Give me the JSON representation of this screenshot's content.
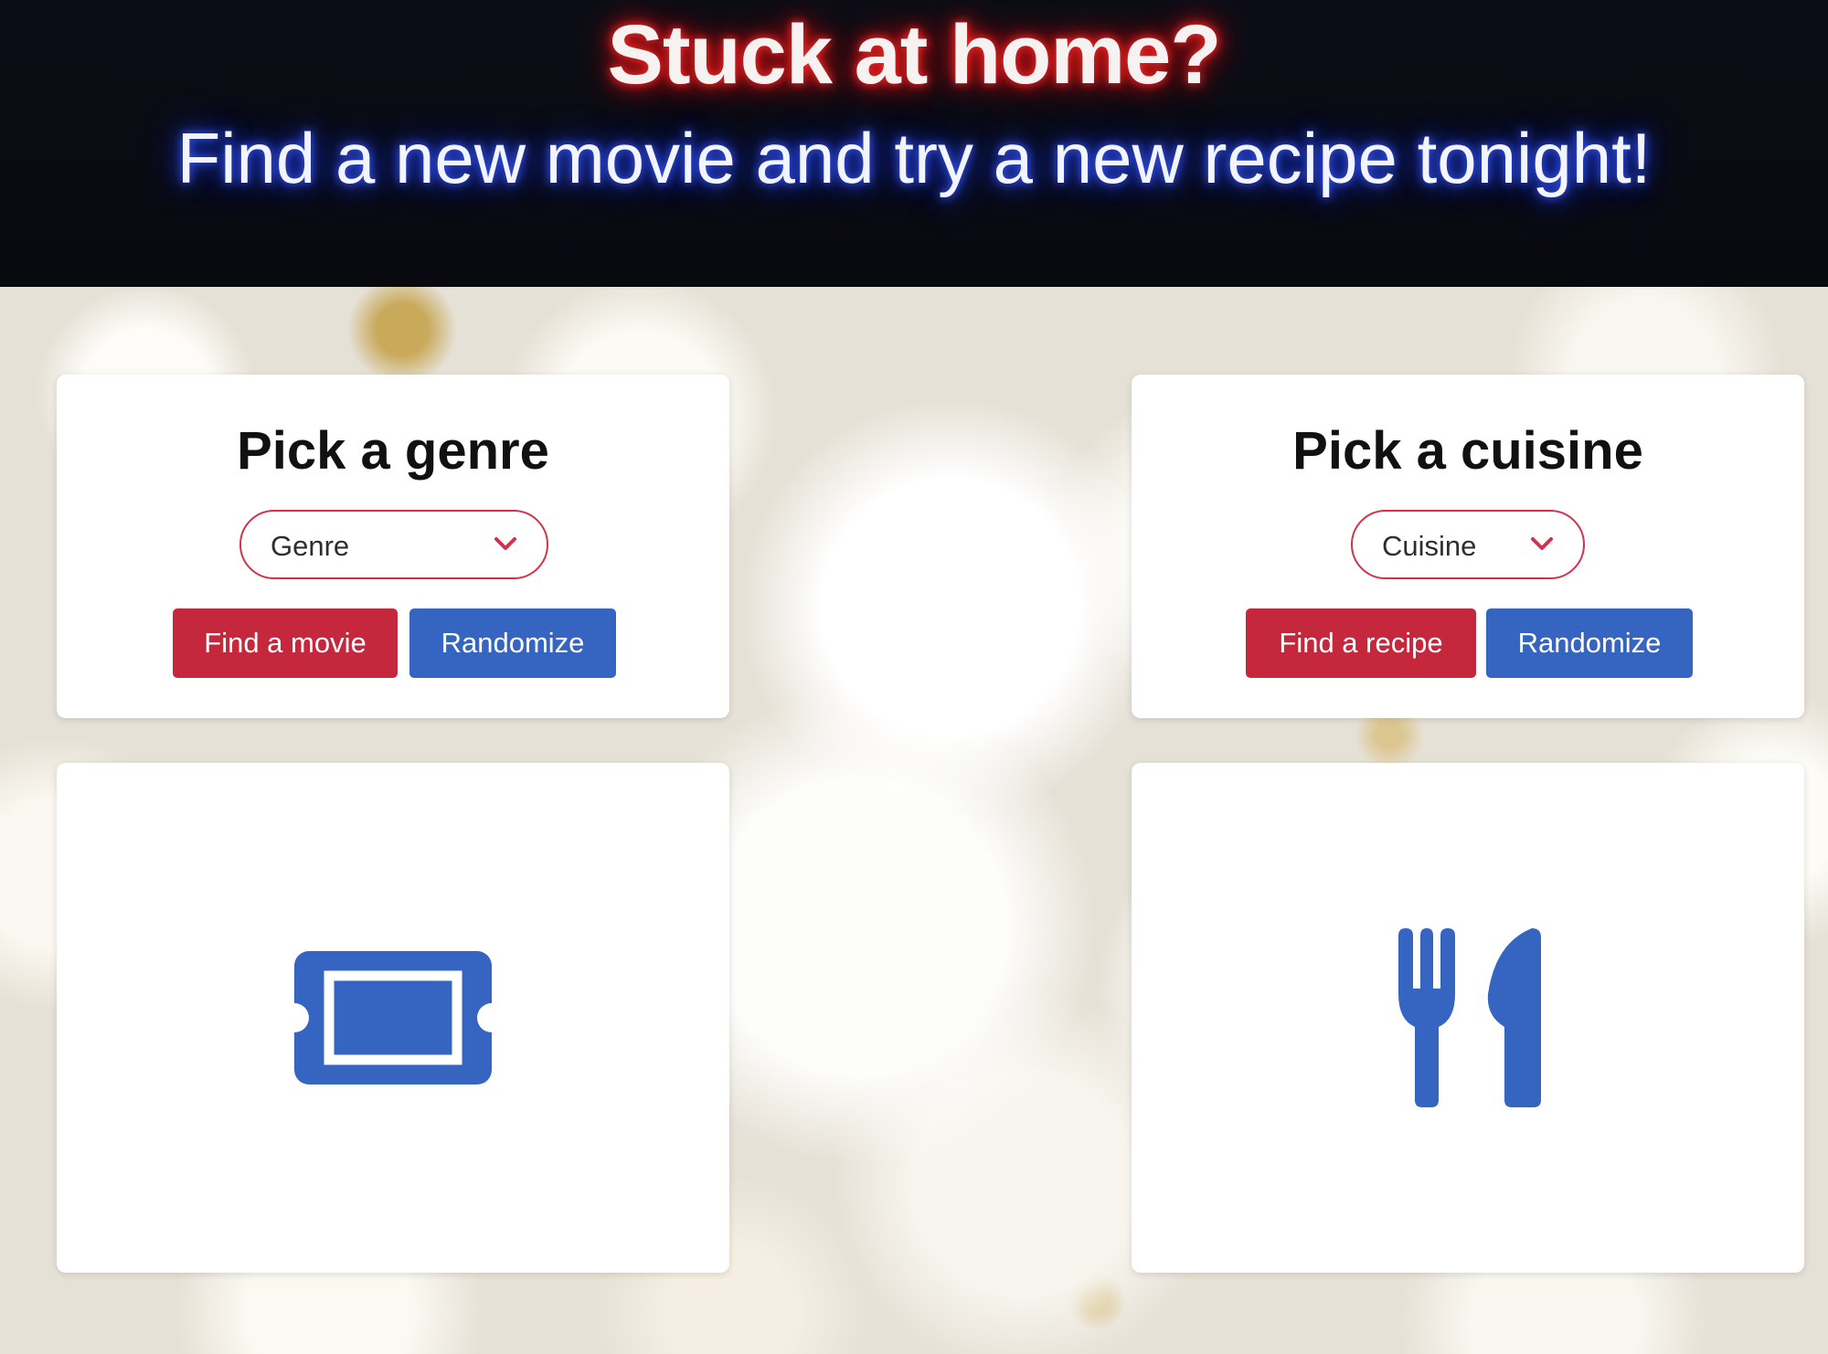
{
  "hero": {
    "title": "Stuck at home?",
    "subtitle": "Find a new movie and try a new recipe tonight!"
  },
  "movie_panel": {
    "title": "Pick a genre",
    "select": {
      "value": "Genre"
    },
    "primary_button": "Find a movie",
    "secondary_button": "Randomize"
  },
  "recipe_panel": {
    "title": "Pick a cuisine",
    "select": {
      "value": "Cuisine"
    },
    "primary_button": "Find a recipe",
    "secondary_button": "Randomize"
  },
  "movie_result": {
    "icon": "ticket-icon"
  },
  "recipe_result": {
    "icon": "utensils-icon"
  },
  "colors": {
    "primary_red": "#c5283c",
    "primary_blue": "#3565c1",
    "select_border": "#d3324d",
    "hero_background": "#0a0b12"
  }
}
